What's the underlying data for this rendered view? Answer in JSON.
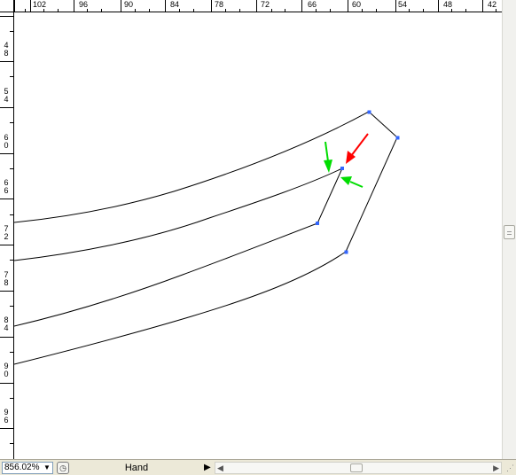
{
  "ruler_top": {
    "labels": [
      "102",
      "96",
      "90",
      "84",
      "78",
      "72",
      "66",
      "60",
      "54",
      "48",
      "42"
    ]
  },
  "ruler_left": {
    "labels": [
      [
        "4",
        "8"
      ],
      [
        "5",
        "4"
      ],
      [
        "6",
        "0"
      ],
      [
        "6",
        "6"
      ],
      [
        "7",
        "2"
      ],
      [
        "7",
        "8"
      ],
      [
        "8",
        "4"
      ],
      [
        "9",
        "0"
      ],
      [
        "9",
        "6"
      ]
    ]
  },
  "status_bar": {
    "zoom_value": "856.02%",
    "zoom_dropdown_icon": "triangle-down-icon",
    "info_icon": "status-info-icon",
    "tool_name": "Hand",
    "play_icon": "triangle-right-icon",
    "scroll_left_icon": "scroll-left-icon",
    "scroll_right_icon": "scroll-right-icon",
    "resize_grip_icon": "resize-grip-icon"
  },
  "canvas": {
    "path_color": "#000000",
    "anchor_color": "#3366ff",
    "annotations": [
      {
        "kind": "arrow",
        "color": "#ff0000"
      },
      {
        "kind": "arrow",
        "color": "#00dd00"
      },
      {
        "kind": "arrow",
        "color": "#00dd00"
      }
    ]
  }
}
